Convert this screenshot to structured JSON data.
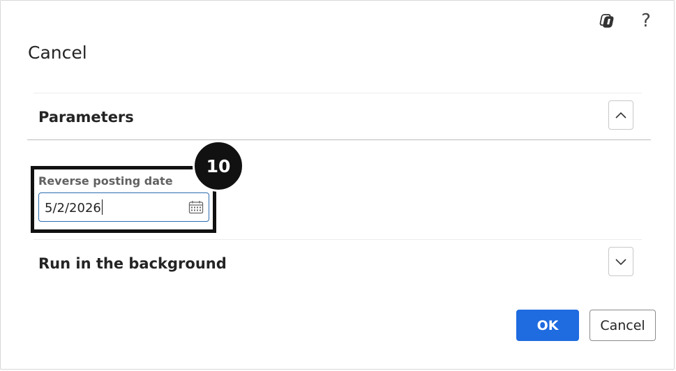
{
  "dialog": {
    "title": "Cancel",
    "top_icons": [
      "copilot-icon",
      "help-icon"
    ],
    "help_glyph": "?"
  },
  "parameters": {
    "header": "Parameters",
    "expanded": true,
    "toggle_icon": "chevron-up-icon",
    "reverse_posting_date": {
      "label": "Reverse posting date",
      "value": "5/2/2026",
      "icon": "calendar-icon"
    }
  },
  "run_in_background": {
    "header": "Run in the background",
    "expanded": false,
    "toggle_icon": "chevron-down-icon"
  },
  "step_badge": {
    "number": "10"
  },
  "buttons": {
    "ok_label": "OK",
    "cancel_label": "Cancel"
  },
  "colors": {
    "primary": "#1f6be0",
    "focus_border": "#2b6cb0",
    "highlight_frame": "#111111"
  }
}
